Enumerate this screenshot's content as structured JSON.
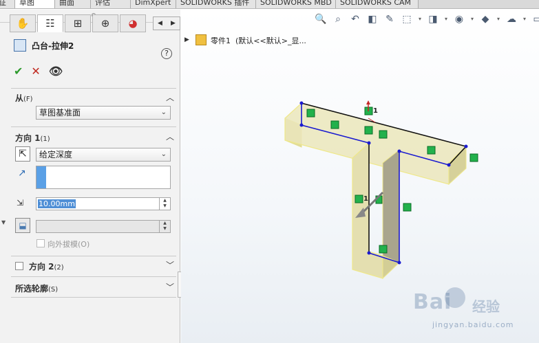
{
  "tabs": [
    "征",
    "草图",
    "曲面",
    "评估",
    "DimXpert",
    "SOLIDWORKS 插件",
    "SOLIDWORKS MBD",
    "SOLIDWORKS CAM"
  ],
  "active_tab_index": 1,
  "tree": {
    "part_label": "零件1",
    "config_label": "(默认<<默认>_显..."
  },
  "feature": {
    "title": "凸台-拉伸2",
    "help": "?",
    "ok": "✔",
    "cancel": "✕",
    "preview": "👁"
  },
  "from_section": {
    "title": "从",
    "hotkey": "(F)",
    "value": "草图基准面"
  },
  "direction1": {
    "title": "方向 1",
    "hotkey": "(1)",
    "end_condition": "给定深度",
    "depth": "10.00mm",
    "draft_label": "向外拔模",
    "draft_hotkey": "(O)"
  },
  "direction2": {
    "title": "方向 2",
    "hotkey": "(2)"
  },
  "selected_contours": {
    "title": "所选轮廓",
    "hotkey": "(S)"
  },
  "view": {
    "top_dim_label": "1",
    "mid_dim_label": "1"
  },
  "watermark": {
    "brand": "Bai",
    "brand_tail": "经验",
    "url": "jingyan.baidu.com"
  },
  "colors": {
    "accent": "#4f8fd6",
    "extrude_fill": "#e8e3b0",
    "sketch_line": "#1a1ad0",
    "relation_marker": "#22b14c"
  }
}
